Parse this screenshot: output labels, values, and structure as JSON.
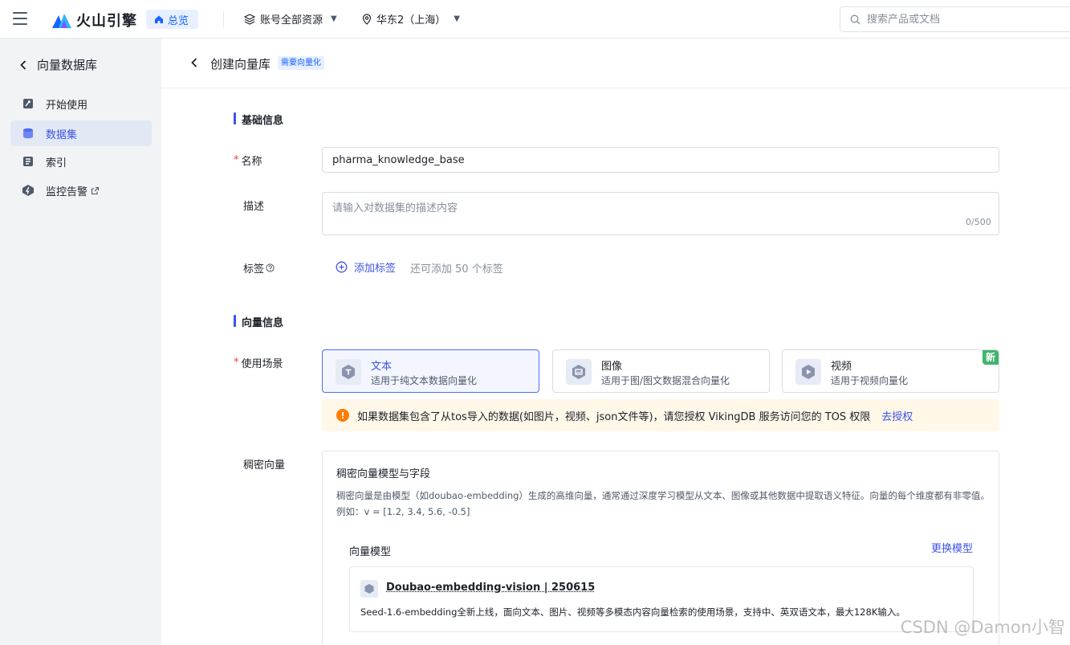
{
  "topbar": {
    "logo_text": "火山引擎",
    "home_label": "总览",
    "account_dropdown": "账号全部资源",
    "region_dropdown": "华东2（上海）",
    "search_placeholder": "搜索产品或文档"
  },
  "sidebar": {
    "title": "向量数据库",
    "items": [
      {
        "label": "开始使用",
        "icon": "rocket-icon"
      },
      {
        "label": "数据集",
        "icon": "database-icon",
        "active": true
      },
      {
        "label": "索引",
        "icon": "index-icon"
      },
      {
        "label": "监控告警",
        "icon": "alert-icon",
        "external": true
      }
    ]
  },
  "page": {
    "title": "创建向量库",
    "badge": "需要向量化"
  },
  "basic": {
    "section_title": "基础信息",
    "name_label": "名称",
    "name_value": "pharma_knowledge_base",
    "desc_label": "描述",
    "desc_placeholder": "请输入对数据集的描述内容",
    "desc_counter": "0/500",
    "tags_label": "标签",
    "add_tag": "添加标签",
    "tag_hint": "还可添加 50 个标签"
  },
  "vector": {
    "section_title": "向量信息",
    "scene_label": "使用场景",
    "scenes": [
      {
        "title": "文本",
        "desc": "适用于纯文本数据向量化",
        "selected": true
      },
      {
        "title": "图像",
        "desc": "适用于图/图文数据混合向量化"
      },
      {
        "title": "视频",
        "desc": "适用于视频向量化",
        "badge": "新"
      }
    ],
    "notice_text": "如果数据集包含了从tos导入的数据(如图片，视频、json文件等)，请您授权 VikingDB 服务访问您的 TOS 权限",
    "notice_link": "去授权",
    "dense_label": "稠密向量",
    "dense_title": "稠密向量模型与字段",
    "dense_desc": "稠密向量是由模型（如doubao-embedding）生成的高维向量，通常通过深度学习模型从文本、图像或其他数据中提取语义特征。向量的每个维度都有非零值。例如：v = [1.2, 3.4, 5.6, -0.5]",
    "model_label": "向量模型",
    "change_model": "更换模型",
    "model_name": "Doubao-embedding-vision | 250615",
    "model_desc": "Seed-1.6-embedding全新上线，面向文本、图片、视频等多模态内容向量检索的使用场景，支持中、英双语文本，最大128K输入。"
  },
  "watermark": "CSDN @Damon小智",
  "colors": {
    "accent": "#3b54e6",
    "brand": "#1664ff",
    "required": "#f53f3f",
    "warning": "#ff7d00",
    "new_badge": "#3fb46d"
  }
}
